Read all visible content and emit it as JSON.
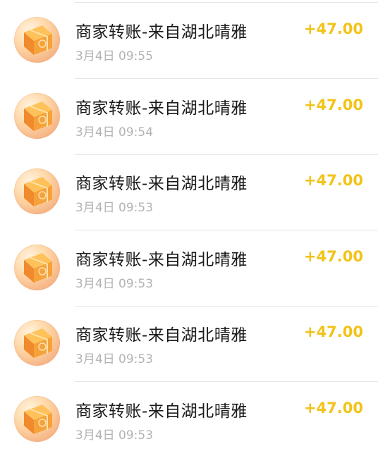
{
  "transactions": [
    {
      "title": "商家转账-来自湖北晴雅",
      "time": "3月4日 09:55",
      "amount": "+47.00",
      "icon": "gift-box-icon"
    },
    {
      "title": "商家转账-来自湖北晴雅",
      "time": "3月4日 09:54",
      "amount": "+47.00",
      "icon": "gift-box-icon"
    },
    {
      "title": "商家转账-来自湖北晴雅",
      "time": "3月4日 09:53",
      "amount": "+47.00",
      "icon": "gift-box-icon"
    },
    {
      "title": "商家转账-来自湖北晴雅",
      "time": "3月4日 09:53",
      "amount": "+47.00",
      "icon": "gift-box-icon"
    },
    {
      "title": "商家转账-来自湖北晴雅",
      "time": "3月4日 09:53",
      "amount": "+47.00",
      "icon": "gift-box-icon"
    },
    {
      "title": "商家转账-来自湖北晴雅",
      "time": "3月4日 09:53",
      "amount": "+47.00",
      "icon": "gift-box-icon"
    }
  ],
  "colors": {
    "amount": "#f2c318",
    "title": "#1a1a1a",
    "time": "#b3b3b3"
  }
}
